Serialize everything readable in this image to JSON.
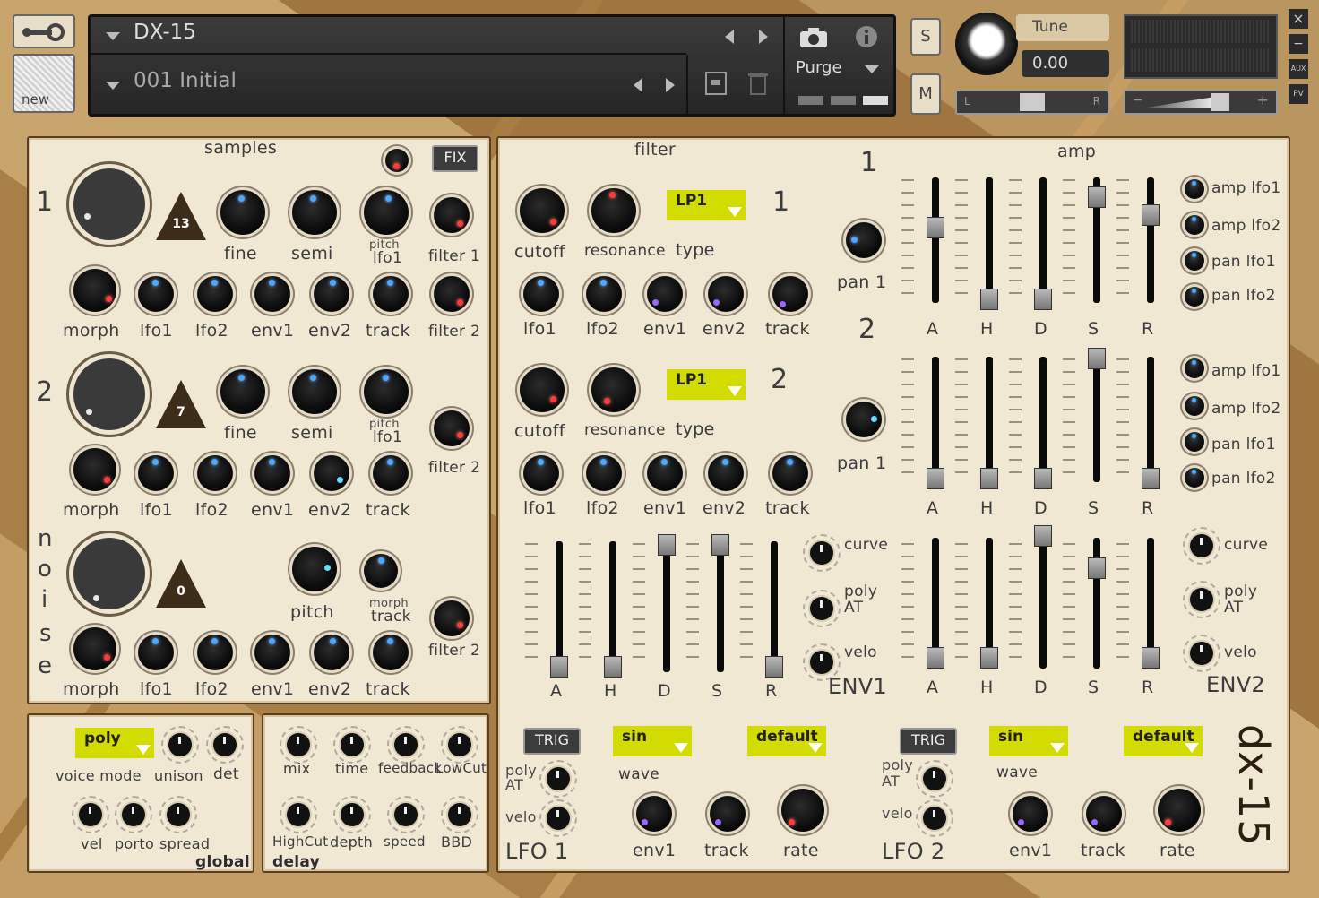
{
  "header": {
    "instrument": "DX-15",
    "preset": "001 Initial",
    "purge": "Purge",
    "solo": "S",
    "mute": "M",
    "tune_label": "Tune",
    "tune_value": "0.00",
    "pan_l": "L",
    "pan_r": "R",
    "new_label": "new",
    "close": "×",
    "minimize": "−",
    "aux": "AUX",
    "pv": "PV",
    "vol_minus": "−",
    "vol_plus": "+"
  },
  "samples": {
    "title": "samples",
    "fix": "FIX",
    "row1_num": "1",
    "row2_num": "2",
    "tri1": "13",
    "tri2": "7",
    "tri3": "0",
    "noise": [
      "n",
      "o",
      "i",
      "s",
      "e"
    ],
    "labels": {
      "fine": "fine",
      "semi": "semi",
      "pitch_small": "pitch",
      "lfo1_small": "lfo1",
      "filter1": "filter 1",
      "filter2": "filter 2",
      "morph": "morph",
      "lfo1": "lfo1",
      "lfo2": "lfo2",
      "env1": "env1",
      "env2": "env2",
      "track": "track",
      "pitch": "pitch",
      "morph_small": "morph",
      "track_small": "track"
    }
  },
  "filter": {
    "title": "filter",
    "num1": "1",
    "num2": "2",
    "type1": "LP1",
    "type2": "LP1",
    "cutoff": "cutoff",
    "resonance": "resonance",
    "type": "type",
    "lfo1": "lfo1",
    "lfo2": "lfo2",
    "env1": "env1",
    "env2": "env2",
    "track": "track"
  },
  "amp": {
    "title": "amp",
    "num1": "1",
    "num2": "2",
    "pan1": "pan 1",
    "pan2": "pan 1",
    "mods": [
      "amp lfo1",
      "amp lfo2",
      "pan lfo1",
      "pan lfo2"
    ]
  },
  "env": {
    "letters": [
      "A",
      "H",
      "D",
      "S",
      "R"
    ],
    "curve": "curve",
    "poly": "poly",
    "at": "AT",
    "velo": "velo",
    "env1": "ENV1",
    "env2": "ENV2"
  },
  "global": {
    "voice_mode_value": "poly",
    "voice_mode": "voice mode",
    "unison": "unison",
    "det": "det",
    "vel": "vel",
    "porto": "porto",
    "spread": "spread",
    "title": "global"
  },
  "delay": {
    "mix": "mix",
    "time": "time",
    "feedback": "feedback",
    "lowcut": "LowCut",
    "highcut": "HighCut",
    "depth": "depth",
    "speed": "speed",
    "bbd": "BBD",
    "title": "delay"
  },
  "lfo1": {
    "trig": "TRIG",
    "wave_value": "sin",
    "mode_value": "default",
    "poly": "poly",
    "at": "AT",
    "velo": "velo",
    "wave": "wave",
    "env1": "env1",
    "track": "track",
    "rate": "rate",
    "title": "LFO 1"
  },
  "lfo2": {
    "trig": "TRIG",
    "wave_value": "sin",
    "mode_value": "default",
    "poly": "poly",
    "at": "AT",
    "velo": "velo",
    "wave": "wave",
    "env1": "env1",
    "track": "track",
    "rate": "rate",
    "title": "LFO 2"
  },
  "logo": "dx-15"
}
